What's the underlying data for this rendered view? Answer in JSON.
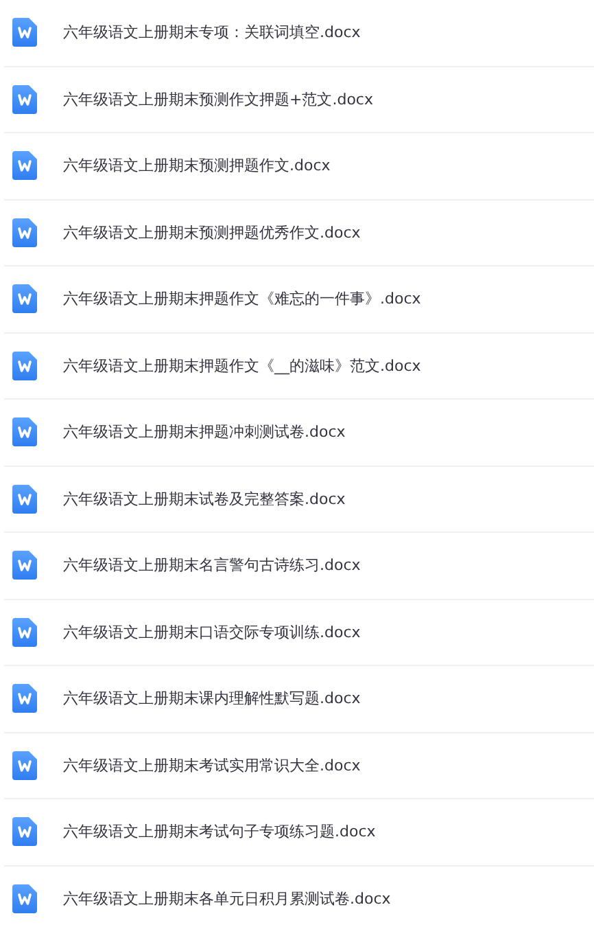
{
  "files": [
    {
      "name": "六年级语文上册期末专项：关联词填空.docx"
    },
    {
      "name": "六年级语文上册期末预测作文押题+范文.docx"
    },
    {
      "name": "六年级语文上册期末预测押题作文.docx"
    },
    {
      "name": "六年级语文上册期末预测押题优秀作文.docx"
    },
    {
      "name": "六年级语文上册期末押题作文《难忘的一件事》.docx"
    },
    {
      "name": "六年级语文上册期末押题作文《__的滋味》范文.docx"
    },
    {
      "name": "六年级语文上册期末押题冲刺测试卷.docx"
    },
    {
      "name": "六年级语文上册期末试卷及完整答案.docx"
    },
    {
      "name": "六年级语文上册期末名言警句古诗练习.docx"
    },
    {
      "name": "六年级语文上册期末口语交际专项训练.docx"
    },
    {
      "name": "六年级语文上册期末课内理解性默写题.docx"
    },
    {
      "name": "六年级语文上册期末考试实用常识大全.docx"
    },
    {
      "name": "六年级语文上册期末考试句子专项练习题.docx"
    },
    {
      "name": "六年级语文上册期末各单元日积月累测试卷.docx"
    }
  ]
}
